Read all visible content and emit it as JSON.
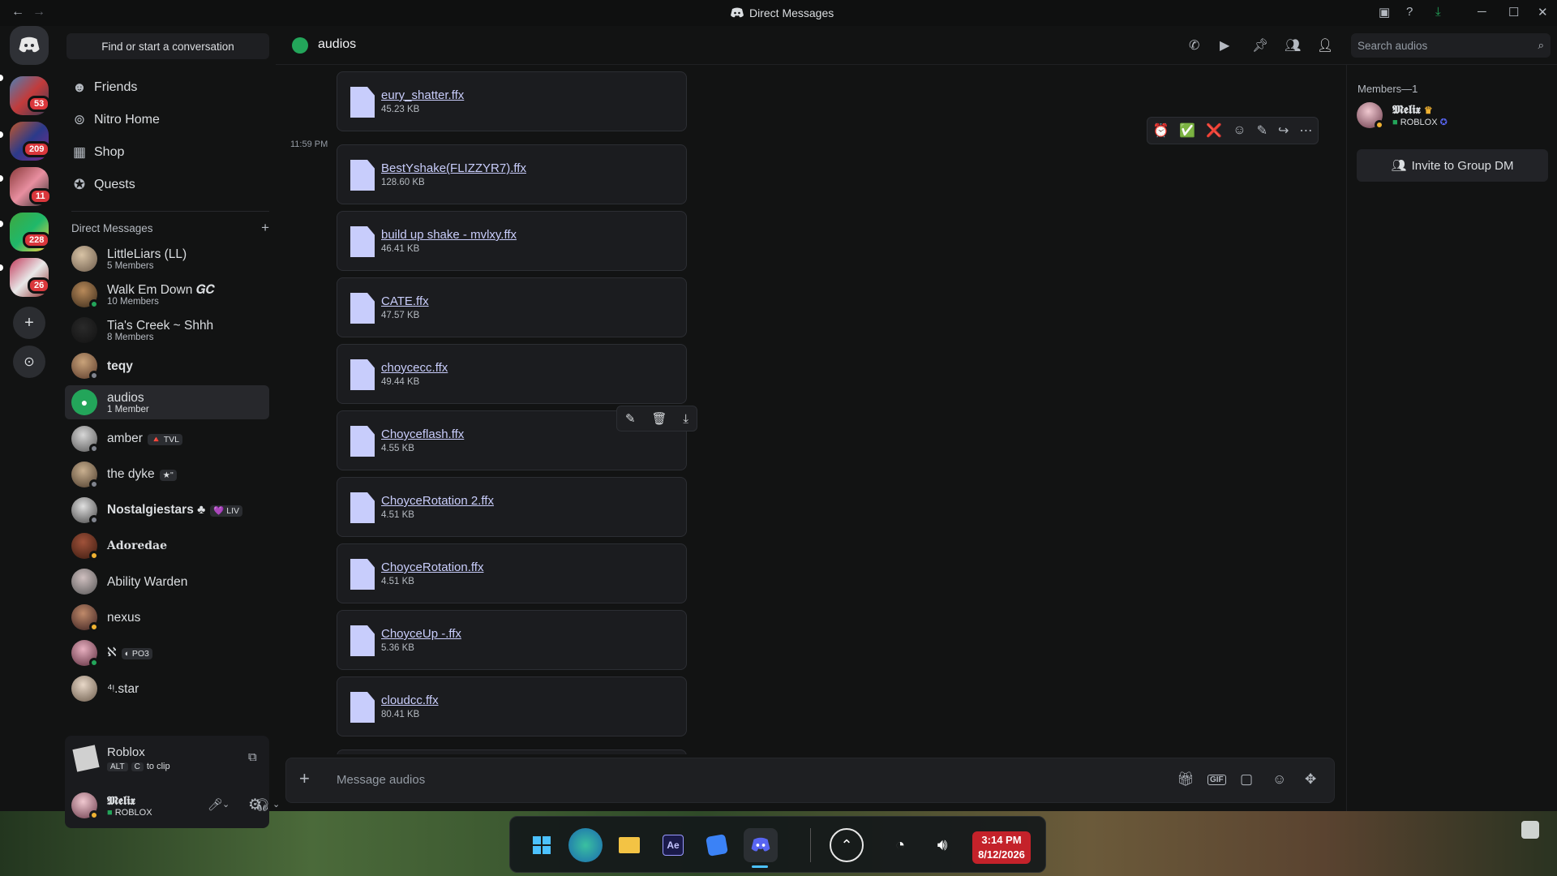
{
  "window": {
    "title": "Direct Messages",
    "back": "←",
    "forward": "→",
    "controls": [
      "─",
      "☐",
      "✕"
    ]
  },
  "rail": {
    "badges": [
      "53",
      "209",
      "11",
      "228",
      "26"
    ],
    "add_server": "+",
    "discover": "⊙"
  },
  "sidebar": {
    "find_placeholder": "Find or start a conversation",
    "nav": [
      {
        "label": "Friends",
        "icon": "friends-icon"
      },
      {
        "label": "Nitro Home",
        "icon": "nitro-icon"
      },
      {
        "label": "Shop",
        "icon": "shop-icon"
      },
      {
        "label": "Quests",
        "icon": "quests-icon"
      }
    ],
    "dm_header": "Direct Messages",
    "dm_add": "+",
    "dms": [
      {
        "name": "LittleLiars (LL)",
        "sub": "5 Members"
      },
      {
        "name": "Walk Em Down 𝑮𝑪",
        "sub": "10 Members"
      },
      {
        "name": "Tia's Creek ~ Shhh",
        "sub": "8 Members"
      },
      {
        "name": "teqy",
        "sub": ""
      },
      {
        "name": "audios",
        "sub": "1 Member"
      },
      {
        "name": "amber",
        "sub": "",
        "tag": "🔺 TVL"
      },
      {
        "name": "the dyke",
        "sub": "",
        "tag": "★\""
      },
      {
        "name": "Nostalgiestars ♣",
        "sub": "",
        "tag": "💜 LIV"
      },
      {
        "name": "Adoredae",
        "sub": ""
      },
      {
        "name": "Ability Warden",
        "sub": ""
      },
      {
        "name": "nexus",
        "sub": ""
      },
      {
        "name": "ℵ",
        "sub": "",
        "tag": "◐ PO3"
      },
      {
        "name": "⁴ᵎ.star",
        "sub": ""
      }
    ],
    "activity": {
      "title": "Roblox",
      "hint_keys": [
        "ALT",
        "C"
      ],
      "hint": "to clip"
    },
    "user": {
      "name": "𝕸𝖊𝖑𝖎𝖝",
      "status": "ROBLOX"
    }
  },
  "header": {
    "channel": "audios",
    "search_placeholder": "Search audios",
    "icons": [
      "phone-icon",
      "video-icon",
      "pin-icon",
      "add-member-icon",
      "members-icon"
    ]
  },
  "messages": {
    "timestamp": "11:59 PM",
    "attachments": [
      {
        "name": "eury_shatter.ffx",
        "size": "45.23 KB"
      },
      {
        "name": "BestYshake(FLIZZYR7).ffx",
        "size": "128.60 KB"
      },
      {
        "name": "build up shake - mvlxy.ffx",
        "size": "46.41 KB"
      },
      {
        "name": "CATE.ffx",
        "size": "47.57 KB"
      },
      {
        "name": "choycecc.ffx",
        "size": "49.44 KB"
      },
      {
        "name": "Choyceflash.ffx",
        "size": "4.55 KB"
      },
      {
        "name": "ChoyceRotation 2.ffx",
        "size": "4.51 KB"
      },
      {
        "name": "ChoyceRotation.ffx",
        "size": "4.51 KB"
      },
      {
        "name": "ChoyceUp -.ffx",
        "size": "5.36 KB"
      },
      {
        "name": "cloudcc.ffx",
        "size": "80.41 KB"
      }
    ],
    "reactions": [
      "⏰",
      "✅",
      "❌",
      "☺",
      "✎",
      "↪",
      "⋯"
    ],
    "file_actions": [
      "✎",
      "🗑",
      "⤓"
    ]
  },
  "composer": {
    "placeholder": "Message audios",
    "add": "+",
    "icons": [
      "gift-icon",
      "gif-icon",
      "sticker-icon",
      "emoji-icon",
      "apps-icon"
    ],
    "gif_label": "GIF"
  },
  "members": {
    "header": "Members—1",
    "member": {
      "name": "𝕸𝖊𝖑𝖎𝖝",
      "status": "ROBLOX"
    },
    "invite": "Invite to Group DM"
  },
  "taskbar": {
    "time": "3:14 PM",
    "date": "8/12/2026",
    "apps": [
      "start-icon",
      "edge-icon",
      "explorer-icon",
      "after-effects-icon",
      "roblox-icon",
      "discord-icon"
    ],
    "ae_label": "Ae"
  }
}
